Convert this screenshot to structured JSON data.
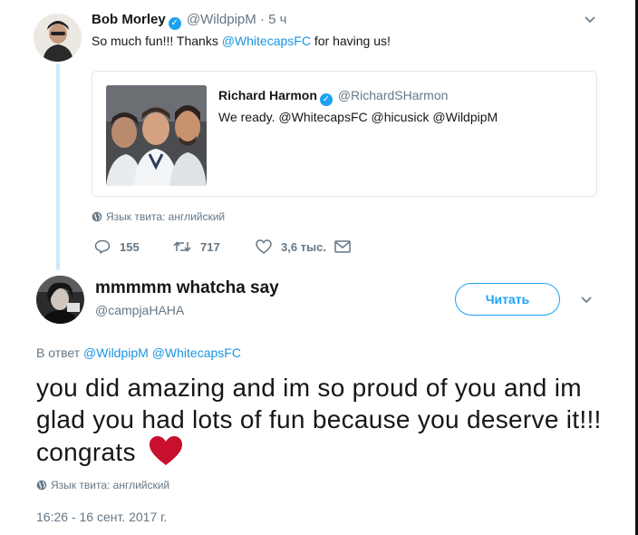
{
  "tweet": {
    "author_name": "Bob Morley",
    "author_handle": "@WildpipM",
    "time": "· 5 ч",
    "text_prefix": "So much fun!!! Thanks ",
    "text_mention": "@WhitecapsFC",
    "text_suffix": " for having us!",
    "quote": {
      "author_name": "Richard Harmon",
      "author_handle": "@RichardSHarmon",
      "text": "We ready. @WhitecapsFC @hicusick @WildpipM"
    },
    "language_note": "Язык твита: английский",
    "actions": {
      "replies": "155",
      "retweets": "717",
      "likes": "3,6 тыс."
    }
  },
  "reply": {
    "author_name": "mmmmm whatcha say",
    "author_handle": "@campjaHAHA",
    "follow_label": "Читать",
    "in_reply_prefix": "В ответ",
    "in_reply_mentions": "@WildpipM @WhitecapsFC",
    "text": "you did amazing and im so proud of you and im glad you had lots of fun because you deserve it!!! congrats",
    "language_note": "Язык твита: английский",
    "timestamp": "16:26 - 16 сент. 2017 г."
  },
  "colors": {
    "accent": "#1da1f2",
    "link": "#1b95e0",
    "muted": "#657786",
    "heart": "#c8102e"
  },
  "icons": [
    "verified-badge-icon",
    "chevron-down-icon",
    "reply-icon",
    "retweet-icon",
    "like-icon",
    "direct-message-icon",
    "globe-icon",
    "heart-emoji"
  ]
}
